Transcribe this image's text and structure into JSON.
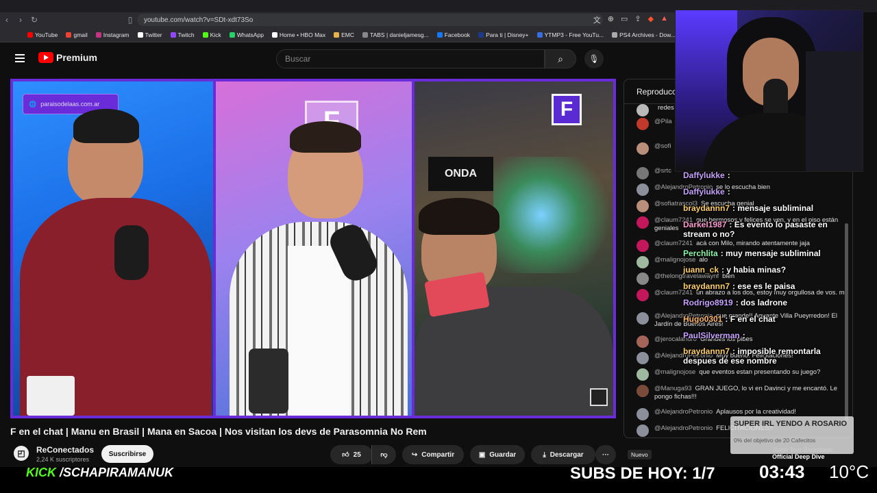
{
  "browser": {
    "url": "youtube.com/watch?v=SDt-xdt73So",
    "bookmarks": [
      {
        "label": "YouTube",
        "color": "#ff0000"
      },
      {
        "label": "gmail",
        "color": "#ea4335"
      },
      {
        "label": "Instagram",
        "color": "#c13584"
      },
      {
        "label": "Twitter",
        "color": "#ffffff"
      },
      {
        "label": "Twitch",
        "color": "#9146ff"
      },
      {
        "label": "Kick",
        "color": "#53fc18"
      },
      {
        "label": "WhatsApp",
        "color": "#25d366"
      },
      {
        "label": "Home • HBO Max",
        "color": "#ffffff"
      },
      {
        "label": "EMC",
        "color": "#e6b34a"
      },
      {
        "label": "TABS | danieljamesg...",
        "color": "#888888"
      },
      {
        "label": "Facebook",
        "color": "#1877f2"
      },
      {
        "label": "Para ti | Disney+",
        "color": "#1c3a8a"
      },
      {
        "label": "YTMP3 - Free YouTu...",
        "color": "#3a6de0"
      },
      {
        "label": "PS4 Archives - Dow...",
        "color": "#aaaaaa"
      }
    ]
  },
  "header": {
    "logo_text": "Premium",
    "search_placeholder": "Buscar"
  },
  "video": {
    "url_badge": "paraisodelaas.com.ar",
    "f_logo": "F",
    "title": "F en el chat | Manu en Brasil | Mana en Sacoa | Nos visitan los devs de Parasomnia No Rem",
    "channel_name": "ReConectados",
    "subscribers": "2,24 K suscriptores",
    "subscribe_label": "Suscribirse",
    "likes": "25",
    "share_label": "Compartir",
    "save_label": "Guardar",
    "download_label": "Descargar",
    "more_label": "···"
  },
  "chat": {
    "header": "Reproducción de chat",
    "messages": [
      {
        "author": "",
        "text": "redes",
        "color": "#b9b9b9"
      },
      {
        "author": "@Pila",
        "text": "me de",
        "color": "#c0392b"
      },
      {
        "author": "@sofi",
        "text": "pibela",
        "color": "#b98e7a"
      },
      {
        "author": "@srtc",
        "text": "",
        "color": "#777777"
      },
      {
        "author": "@AlejandroPetronio",
        "text": "se lo escucha bien",
        "color": "#8a8f9a"
      },
      {
        "author": "@sofiatrascol3",
        "text": "Se escucha genial",
        "color": "#b98e7a"
      },
      {
        "author": "@claum7241",
        "text": "que hermosos y felices se ven, y en el piso están geniales",
        "color": "#c2185b"
      },
      {
        "author": "@claum7241",
        "text": "acá con Milo, mirando atentamente jaja",
        "color": "#c2185b"
      },
      {
        "author": "@malignojose",
        "text": "alo",
        "color": "#9fb9a0"
      },
      {
        "author": "@thelongtravelawaynf",
        "text": "bien",
        "color": "#888888"
      },
      {
        "author": "@claum7241",
        "text": "un abrazo a los dos, estoy muy orgullosa de vos. me",
        "color": "#c2185b"
      },
      {
        "author": "@AlejandroPetronio",
        "text": "que grande!! Aguante Villa Pueyrredon! El Jardín de Buenos Aires!",
        "color": "#8a8f9a"
      },
      {
        "author": "@jerocalandro",
        "text": "Grandes los pibes",
        "color": "#a5645a"
      },
      {
        "author": "@AlejandroPetronio",
        "text": "Muy bueno! Felicitaciones!",
        "color": "#8a8f9a"
      },
      {
        "author": "@malignojose",
        "text": "que eventos estan presentando su juego?",
        "color": "#9fb9a0"
      },
      {
        "author": "@Manuga93",
        "text": "GRAN JUEGO, lo vi en Davinci y me encantó. Le pongo fichas!!!",
        "color": "#7a4a3a"
      },
      {
        "author": "@AlejandroPetronio",
        "text": "Aplausos por la creatividad!",
        "color": "#8a8f9a"
      },
      {
        "author": "@AlejandroPetronio",
        "text": "FELICITACIONES!!",
        "color": "#8a8f9a"
      }
    ]
  },
  "stream_chat": [
    {
      "user": "Daffylukke",
      "text": ":",
      "color": "#c8a2ff"
    },
    {
      "user": "Daffylukke",
      "text": ":",
      "color": "#c8a2ff"
    },
    {
      "user": "braydannn7",
      "text": ": mensaje subliminal",
      "color": "#ffd166"
    },
    {
      "user": "Darkel1987",
      "text": ": Es evento lo pasaste en stream o no?",
      "color": "#ff9bd2"
    },
    {
      "user": "Perchlita",
      "text": ": muy mensaje subliminal",
      "color": "#8cf5a8"
    },
    {
      "user": "juann_ck",
      "text": ": y habia minas?",
      "color": "#ffd166"
    },
    {
      "user": "braydannn7",
      "text": ": ese es le paisa",
      "color": "#ffd166"
    },
    {
      "user": "Rodrigo8919",
      "text": ": dos ladrone",
      "color": "#c8a2ff"
    },
    {
      "user": "Hugo0301",
      "text": ": F en el chat",
      "color": "#ffb86b"
    },
    {
      "user": "PaulSilverman",
      "text": ":",
      "color": "#c8a2ff"
    },
    {
      "user": "braydannn7",
      "text": ": imposible remontarla despues de ese nombre",
      "color": "#ffd166"
    }
  ],
  "goal": {
    "title": "SUPER IRL YENDO A ROSARIO",
    "progress_percent": 0,
    "status": "0% del objetivo de 20 Cafecitos"
  },
  "stream_footer": {
    "kick_prefix": "KICK",
    "kick_channel": "/SCHAPIRAMANUK",
    "subs_today": "SUBS DE HOY: 1/7",
    "clock": "03:43",
    "temperature": "10°C",
    "new_badge": "Nuevo",
    "stage_line1": "Stage Tour Backstage:",
    "stage_line2": "Official Deep Dive"
  }
}
